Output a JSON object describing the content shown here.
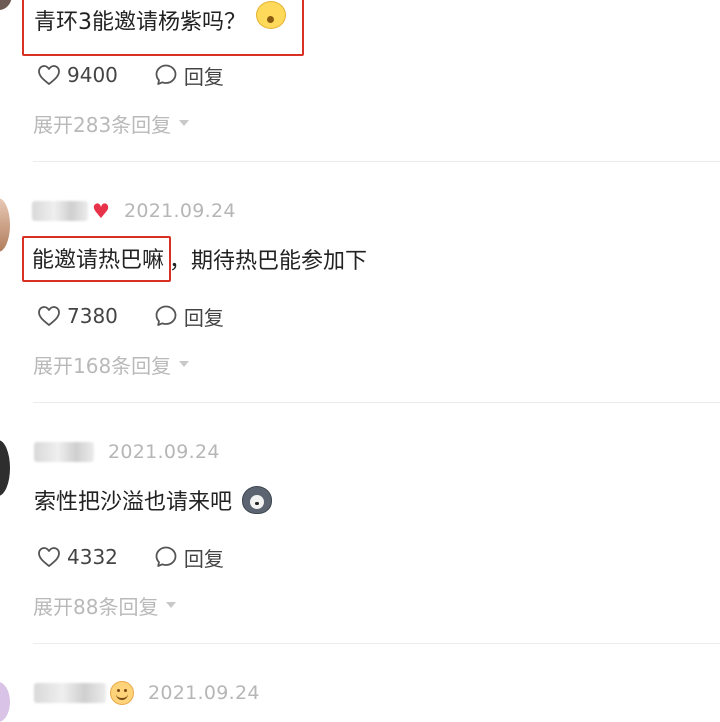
{
  "comments": [
    {
      "date": "",
      "text": "青环3能邀请杨紫吗？",
      "likes": "9400",
      "reply_label": "回复",
      "expand_label": "展开283条回复"
    },
    {
      "date": "2021.09.24",
      "text_highlight": "能邀请热巴嘛",
      "text_rest": "，期待热巴能参加下",
      "likes": "7380",
      "reply_label": "回复",
      "expand_label": "展开168条回复",
      "badge": "heart-icon"
    },
    {
      "date": "2021.09.24",
      "text": "索性把沙溢也请来吧",
      "likes": "4332",
      "reply_label": "回复",
      "expand_label": "展开88条回复",
      "emoji": "husky-emoji-icon"
    },
    {
      "date": "2021.09.24",
      "badge": "smile-emoji-icon"
    }
  ],
  "colors": {
    "highlight_box": "#d93025",
    "secondary_text": "#b6b6b6",
    "heart_badge": "#e8324a"
  }
}
